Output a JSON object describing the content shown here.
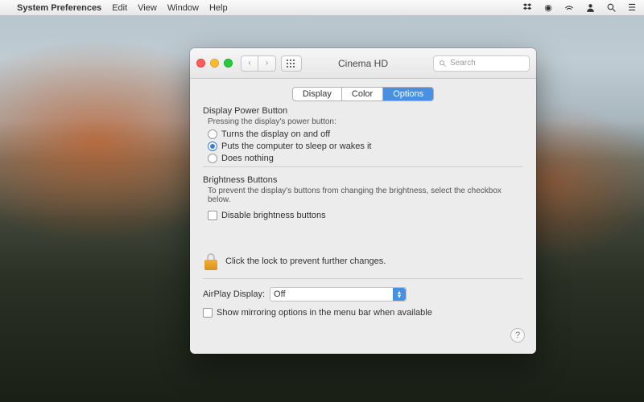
{
  "menubar": {
    "app": "System Preferences",
    "items": [
      "Edit",
      "View",
      "Window",
      "Help"
    ]
  },
  "window": {
    "title": "Cinema HD",
    "search_placeholder": "Search",
    "tabs": [
      "Display",
      "Color",
      "Options"
    ],
    "active_tab": "Options",
    "power_section": {
      "title": "Display Power Button",
      "subtitle": "Pressing the display's power button:",
      "options": [
        "Turns the display on and off",
        "Puts the computer to sleep or wakes it",
        "Does nothing"
      ],
      "selected": 1
    },
    "brightness_section": {
      "title": "Brightness Buttons",
      "subtitle": "To prevent the display's buttons from changing the brightness, select the checkbox below.",
      "checkbox_label": "Disable brightness buttons",
      "checked": false
    },
    "lock_text": "Click the lock to prevent further changes.",
    "airplay": {
      "label": "AirPlay Display:",
      "value": "Off"
    },
    "mirror": {
      "label": "Show mirroring options in the menu bar when available",
      "checked": false
    }
  }
}
